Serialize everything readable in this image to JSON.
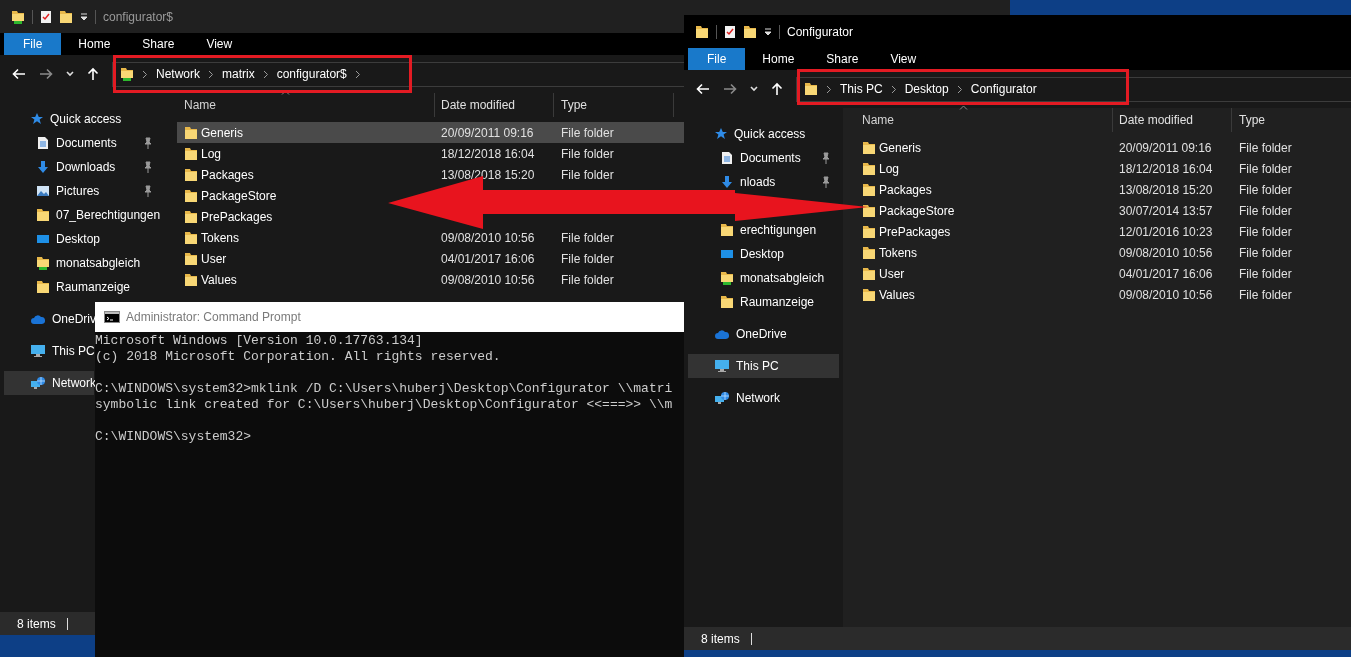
{
  "left_explorer": {
    "title": "configurator$",
    "active": false,
    "ribbon_tabs": [
      {
        "label": "File",
        "selected": true
      },
      {
        "label": "Home",
        "selected": false
      },
      {
        "label": "Share",
        "selected": false
      },
      {
        "label": "View",
        "selected": false
      }
    ],
    "breadcrumb": [
      "Network",
      "matrix",
      "configurator$"
    ],
    "more_chevron": true,
    "columns": [
      "Name",
      "Date modified",
      "Type"
    ],
    "navigation": [
      {
        "label": "Quick access",
        "selected": false,
        "children": [
          {
            "label": "Documents",
            "pinned": true,
            "selected": false
          },
          {
            "label": "Downloads",
            "pinned": true,
            "selected": false
          },
          {
            "label": "Pictures",
            "pinned": true,
            "selected": false
          },
          {
            "label": "07_Berechtigungen",
            "pinned": false,
            "selected": false
          },
          {
            "label": "Desktop",
            "pinned": false,
            "selected": false
          },
          {
            "label": "monatsabgleich",
            "pinned": false,
            "selected": false
          },
          {
            "label": "Raumanzeige",
            "pinned": false,
            "selected": false
          }
        ]
      },
      {
        "label": "OneDriv",
        "selected": false
      },
      {
        "label": "This PC",
        "selected": false
      },
      {
        "label": "Network",
        "selected": true
      }
    ],
    "files": [
      {
        "name": "Generis",
        "date_modified": "20/09/2011 09:16",
        "type": "File folder",
        "selected": true
      },
      {
        "name": "Log",
        "date_modified": "18/12/2018 16:04",
        "type": "File folder",
        "selected": false
      },
      {
        "name": "Packages",
        "date_modified": "13/08/2018 15:20",
        "type": "File folder",
        "selected": false
      },
      {
        "name": "PackageStore",
        "selected": false
      },
      {
        "name": "PrePackages",
        "selected": false
      },
      {
        "name": "Tokens",
        "date_modified": "09/08/2010 10:56",
        "type": "File folder",
        "selected": false
      },
      {
        "name": "User",
        "date_modified": "04/01/2017 16:06",
        "type": "File folder",
        "selected": false
      },
      {
        "name": "Values",
        "date_modified": "09/08/2010 10:56",
        "type": "File folder",
        "selected": false
      }
    ],
    "status": "8 items"
  },
  "command_prompt": {
    "title": "Administrator: Command Prompt",
    "active": false,
    "output": [
      [
        "Microsoft Windows [Version 10.0.17763.134]",
        "(c) 2018 Microsoft Corporation. All rights reserved."
      ],
      [
        "C:\\WINDOWS\\system32>mklink /D C:\\Users\\huberj\\Desktop\\Configurator \\\\matri",
        "symbolic link created for C:\\Users\\huberj\\Desktop\\Configurator <<===>> \\\\m"
      ],
      [
        "C:\\WINDOWS\\system32>"
      ]
    ]
  },
  "right_explorer": {
    "title": "Configurator",
    "active": true,
    "ribbon_tabs": [
      {
        "label": "File",
        "selected": true
      },
      {
        "label": "Home",
        "selected": false
      },
      {
        "label": "Share",
        "selected": false
      },
      {
        "label": "View",
        "selected": false
      }
    ],
    "breadcrumb": [
      "This PC",
      "Desktop",
      "Configurator"
    ],
    "more_chevron": false,
    "columns": [
      "Name",
      "Date modified",
      "Type"
    ],
    "navigation": [
      {
        "label": "Quick access",
        "selected": false,
        "children": [
          {
            "kind": "item",
            "label": "Documents",
            "pinned": true,
            "selected": false
          },
          {
            "kind": "item",
            "label": "nloads",
            "pinned": true,
            "selected": false
          },
          {
            "kind": "covered"
          },
          {
            "kind": "item",
            "label": "erechtigungen",
            "pinned": false,
            "selected": false
          },
          {
            "kind": "item",
            "label": "Desktop",
            "pinned": false,
            "selected": false
          },
          {
            "kind": "item",
            "label": "monatsabgleich",
            "pinned": false,
            "selected": false
          },
          {
            "kind": "item",
            "label": "Raumanzeige",
            "pinned": false,
            "selected": false
          }
        ]
      },
      {
        "label": "OneDrive",
        "selected": false
      },
      {
        "label": "This PC",
        "selected": true
      },
      {
        "label": "Network",
        "selected": false
      }
    ],
    "files": [
      {
        "name": "Generis",
        "date_modified": "20/09/2011 09:16",
        "type": "File folder",
        "selected": false
      },
      {
        "name": "Log",
        "date_modified": "18/12/2018 16:04",
        "type": "File folder",
        "selected": false
      },
      {
        "name": "Packages",
        "date_modified": "13/08/2018 15:20",
        "type": "File folder",
        "selected": false
      },
      {
        "name": "PackageStore",
        "date_modified": "30/07/2014 13:57",
        "type": "File folder",
        "selected": false
      },
      {
        "name": "PrePackages",
        "date_modified": "12/01/2016 10:23",
        "type": "File folder",
        "selected": false
      },
      {
        "name": "Tokens",
        "date_modified": "09/08/2010 10:56",
        "type": "File folder",
        "selected": false
      },
      {
        "name": "User",
        "date_modified": "04/01/2017 16:06",
        "type": "File folder",
        "selected": false
      },
      {
        "name": "Values",
        "date_modified": "09/08/2010 10:56",
        "type": "File folder",
        "selected": false
      }
    ],
    "status": "8 items"
  }
}
